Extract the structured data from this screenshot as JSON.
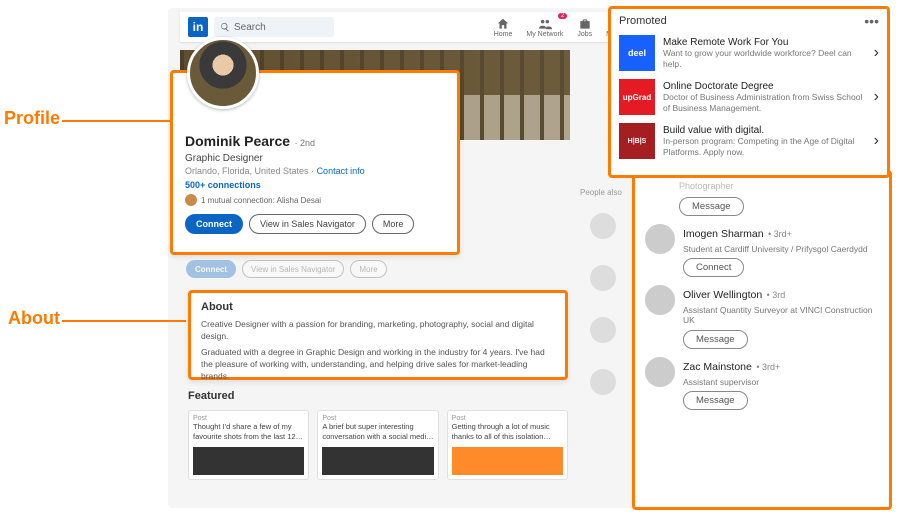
{
  "annotations": {
    "profile": "Profile",
    "about": "About"
  },
  "nav": {
    "search_placeholder": "Search",
    "items": [
      {
        "label": "Home"
      },
      {
        "label": "My Network",
        "badge": "2"
      },
      {
        "label": "Jobs"
      },
      {
        "label": "Messaging"
      }
    ]
  },
  "profile": {
    "name": "Dominik Pearce",
    "degree": "· 2nd",
    "title": "Graphic Designer",
    "location": "Orlando, Florida, United States · ",
    "contact": "Contact info",
    "connections": "500+ connections",
    "mutual": "1 mutual connection: Alisha Desai",
    "buttons": {
      "connect": "Connect",
      "sales": "View in Sales Navigator",
      "more": "More"
    }
  },
  "about": {
    "heading": "About",
    "p1": "Creative Designer with a passion for branding, marketing, photography, social and digital design.",
    "p2": "Graduated with a degree in Graphic Design and working in the industry for 4 years. I've had the pleasure of working with, understanding, and helping drive sales for market-leading brands."
  },
  "featured": {
    "heading": "Featured",
    "post_label": "Post",
    "posts": [
      "Thought I'd share a few of my favourite shots from the last 12…",
      "A brief but super interesting conversation with a social medi…",
      "Getting through a lot of music thanks to all of this isolation…"
    ]
  },
  "promoted": {
    "heading": "Promoted",
    "items": [
      {
        "logo": "deel",
        "title": "Make Remote Work For You",
        "desc": "Want to grow your worldwide workforce? Deel can help."
      },
      {
        "logo": "upGrad",
        "title": "Online Doctorate Degree",
        "desc": "Doctor of Business Administration from Swiss School of Business Management."
      },
      {
        "logo": "H|B|S",
        "title": "Build value with digital.",
        "desc": "In-person program: Competing in the Age of Digital Platforms. Apply now."
      }
    ]
  },
  "people": {
    "also_label": "People also",
    "ghost_role": "Photographer",
    "message_label": "Message",
    "connect_label": "Connect",
    "list": [
      {
        "name": "Imogen Sharman",
        "degree": "• 3rd+",
        "role": "Student at Cardiff University / Prifysgol Caerdydd",
        "action": "connect"
      },
      {
        "name": "Oliver Wellington",
        "degree": "• 3rd",
        "role": "Assistant Quantity Surveyor at VINCI Construction UK",
        "action": "message"
      },
      {
        "name": "Zac Mainstone",
        "degree": "• 3rd+",
        "role": "Assistant supervisor",
        "action": "message"
      }
    ]
  }
}
